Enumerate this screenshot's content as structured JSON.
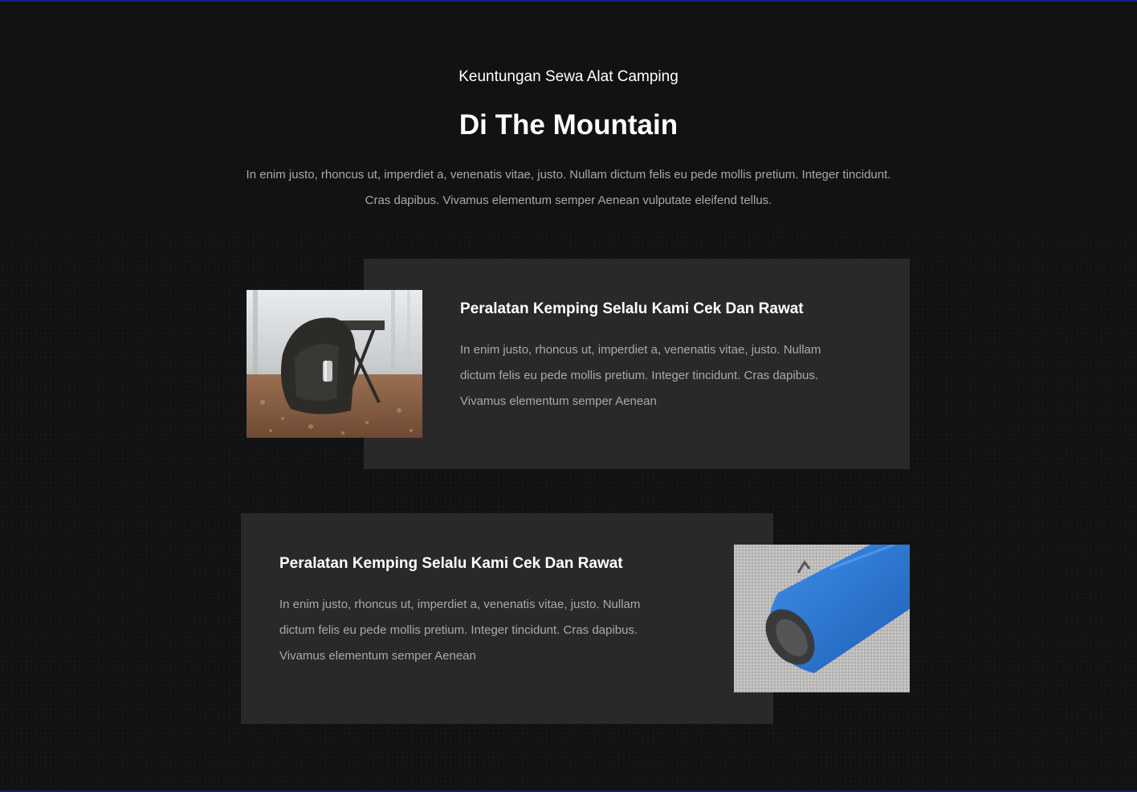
{
  "section": {
    "eyebrow": "Keuntungan Sewa Alat Camping",
    "title": "Di The Mountain",
    "intro": "In enim justo, rhoncus ut, imperdiet a, venenatis vitae, justo. Nullam dictum felis eu pede mollis pretium. Integer tincidunt. Cras dapibus. Vivamus elementum semper Aenean vulputate eleifend tellus."
  },
  "features": [
    {
      "title": "Peralatan Kemping Selalu Kami Cek Dan Rawat",
      "text": "In enim justo, rhoncus ut, imperdiet a, venenatis vitae, justo. Nullam dictum felis eu pede mollis pretium. Integer tincidunt. Cras dapibus. Vivamus elementum semper Aenean",
      "image": "backpack-with-camp-stool-photo"
    },
    {
      "title": "Peralatan Kemping Selalu Kami Cek Dan Rawat",
      "text": "In enim justo, rhoncus ut, imperdiet a, venenatis vitae, justo. Nullam dictum felis eu pede mollis pretium. Integer tincidunt. Cras dapibus. Vivamus elementum semper Aenean",
      "image": "blue-sleeping-bag-photo"
    }
  ],
  "colors": {
    "background": "#111213",
    "card": "#29292a",
    "heading": "#ffffff",
    "body_text": "#a9a9a9",
    "accent_line": "#1a1a8a"
  }
}
